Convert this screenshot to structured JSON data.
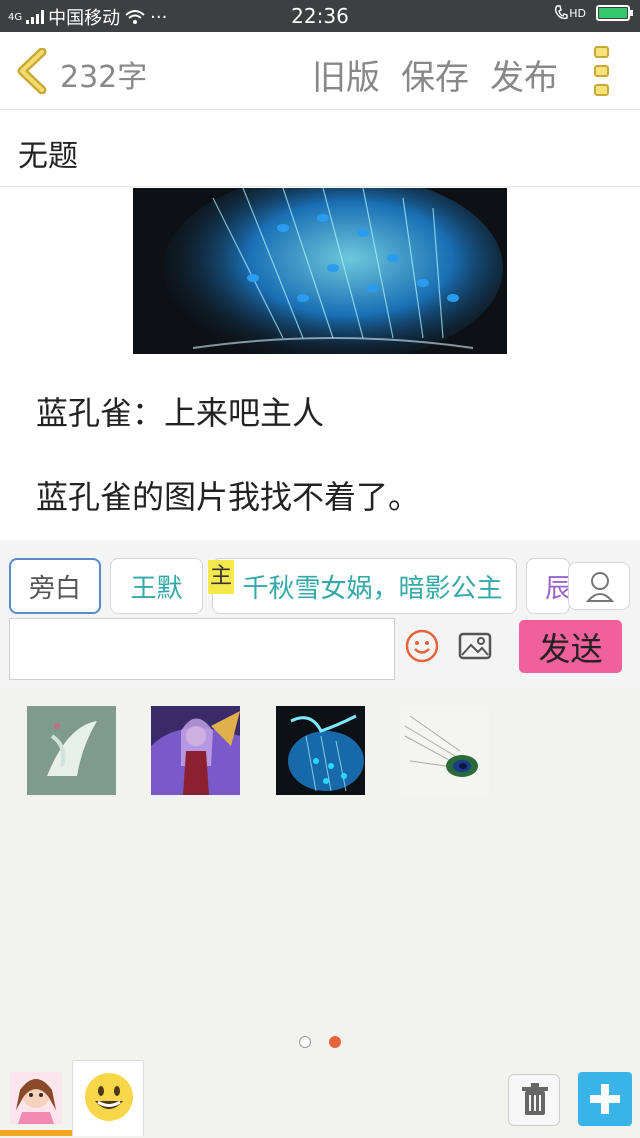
{
  "status_bar": {
    "network": "4G",
    "carrier": "中国移动",
    "more": "···",
    "time": "22:36",
    "hd": "HD"
  },
  "header": {
    "word_count": "232字",
    "old_version": "旧版",
    "save": "保存",
    "publish": "发布"
  },
  "title": "无题",
  "content": {
    "image_icon": "peacock-image",
    "lines": [
      "蓝孔雀：上来吧主人",
      "蓝孔雀的图片我找不着了。"
    ]
  },
  "roles": {
    "chips": [
      "旁白",
      "王默",
      "千秋雪女娲，暗影公主",
      "辰"
    ],
    "master_tag": "主",
    "selected_index": 0
  },
  "composer": {
    "input_value": "",
    "send_label": "发送"
  },
  "picker": {
    "thumbnails": [
      "white-crane-thumbnail",
      "warrior-girl-thumbnail",
      "blue-peacock-thumbnail",
      "peacock-feather-thumbnail"
    ],
    "page_count": 2,
    "active_page": 2
  },
  "colors": {
    "accent_send": "#f0609a",
    "accent_add": "#3ab4e8",
    "chip_text": "#35a8a8",
    "active_tab": "#f5a623"
  }
}
